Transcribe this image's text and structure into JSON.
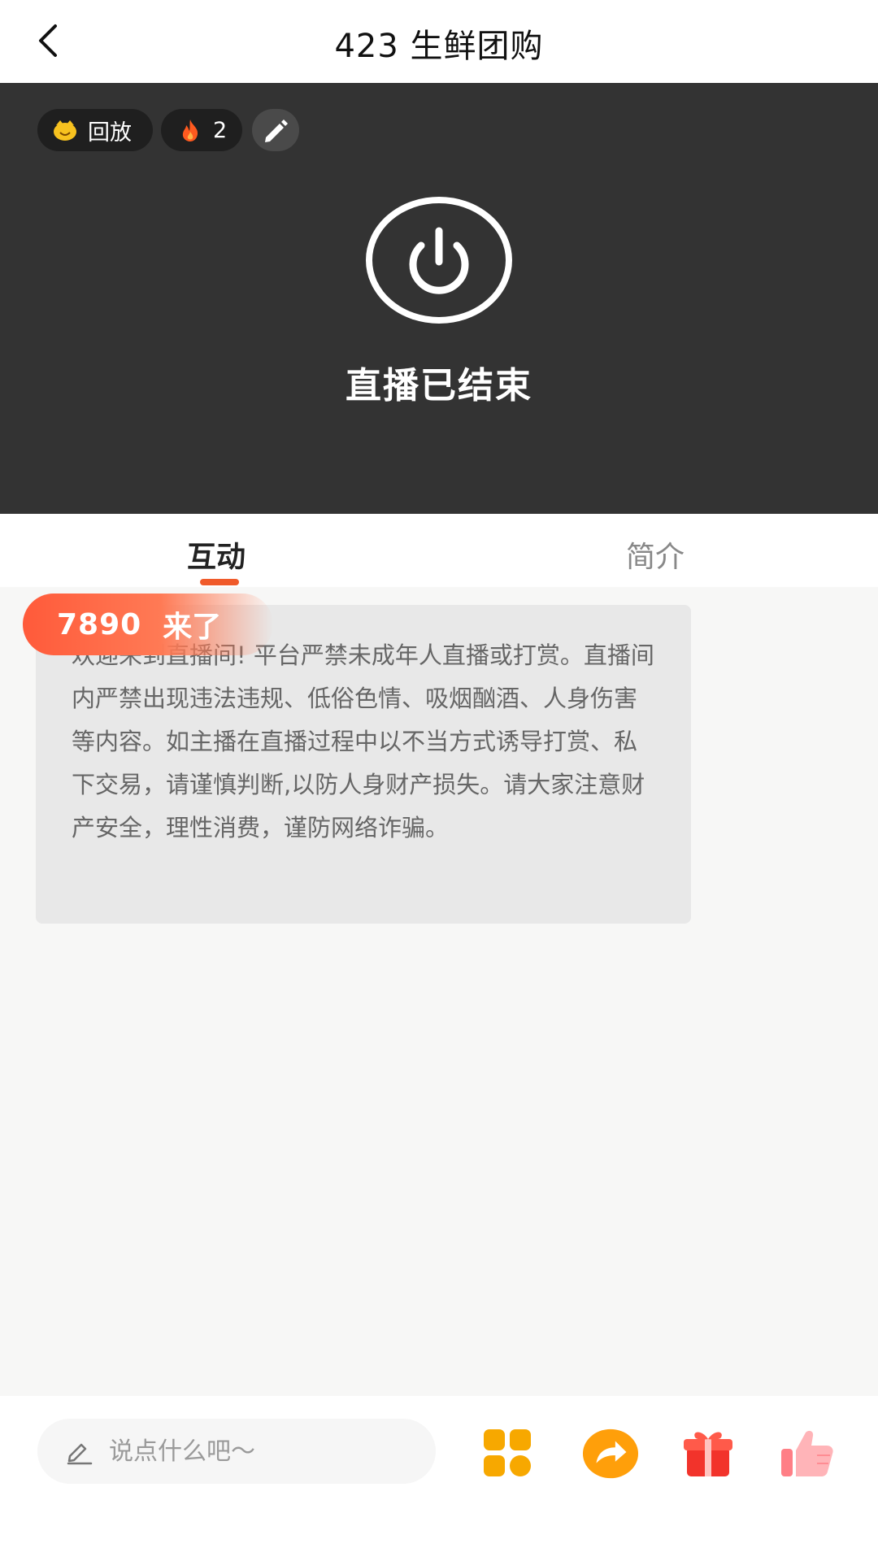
{
  "header": {
    "title": "423 生鲜团购"
  },
  "video": {
    "replay_label": "回放",
    "heat_count": "2",
    "ended_text": "直播已结束"
  },
  "tabs": [
    {
      "label": "互动"
    },
    {
      "label": "简介"
    }
  ],
  "chat": {
    "join_name": "7890",
    "join_suffix": "来了",
    "notice": "欢迎来到直播间! 平台严禁未成年人直播或打赏。直播间内严禁出现违法违规、低俗色情、吸烟酗酒、人身伤害等内容。如主播在直播过程中以不当方式诱导打赏、私下交易，请谨慎判断,以防人身财产损失。请大家注意财产安全，理性消费，谨防网络诈骗。"
  },
  "bottom": {
    "input_placeholder": "说点什么吧～"
  },
  "colors": {
    "accent": "#f05a2a",
    "video_bg": "#333333"
  }
}
